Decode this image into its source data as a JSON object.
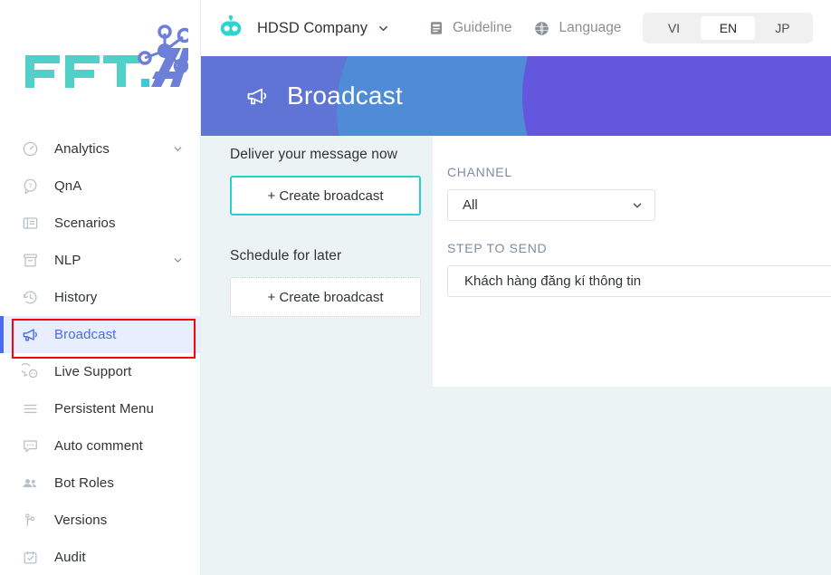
{
  "brand": {
    "logo_text": "FPT.AI"
  },
  "sidebar": {
    "items": [
      {
        "label": "Analytics",
        "icon": "gauge-icon",
        "chevron": true,
        "active": false
      },
      {
        "label": "QnA",
        "icon": "question-chat-icon",
        "chevron": false,
        "active": false
      },
      {
        "label": "Scenarios",
        "icon": "article-icon",
        "chevron": false,
        "active": false
      },
      {
        "label": "NLP",
        "icon": "archive-icon",
        "chevron": true,
        "active": false
      },
      {
        "label": "History",
        "icon": "clock-history-icon",
        "chevron": false,
        "active": false
      },
      {
        "label": "Broadcast",
        "icon": "megaphone-icon",
        "chevron": false,
        "active": true
      },
      {
        "label": "Live Support",
        "icon": "support-chat-icon",
        "chevron": false,
        "active": false
      },
      {
        "label": "Persistent Menu",
        "icon": "menu-lines-icon",
        "chevron": false,
        "active": false
      },
      {
        "label": "Auto comment",
        "icon": "comment-icon",
        "chevron": false,
        "active": false
      },
      {
        "label": "Bot Roles",
        "icon": "people-icon",
        "chevron": false,
        "active": false
      },
      {
        "label": "Versions",
        "icon": "branch-icon",
        "chevron": false,
        "active": false
      },
      {
        "label": "Audit",
        "icon": "calendar-check-icon",
        "chevron": false,
        "active": false
      }
    ],
    "active_highlight_color": "#4a6cf0",
    "annotation_color": "#f5060a"
  },
  "topbar": {
    "company_name": "HDSD Company",
    "company_icon": "robot-icon",
    "company_caret": "chevron-down-icon",
    "guideline_label": "Guideline",
    "guideline_icon": "document-icon",
    "language_label": "Language",
    "language_icon": "globe-icon",
    "languages": [
      {
        "code": "VI",
        "selected": false
      },
      {
        "code": "EN",
        "selected": true
      },
      {
        "code": "JP",
        "selected": false
      }
    ]
  },
  "banner": {
    "title": "Broadcast",
    "icon": "megaphone-icon",
    "color_base": "#5f74d4",
    "color_blue": "#4f8bd6",
    "color_purple": "#6257dd"
  },
  "main": {
    "deliver_now_title": "Deliver your message now",
    "deliver_now_button": "+ Create broadcast",
    "schedule_title": "Schedule for later",
    "schedule_button": "+ Create broadcast",
    "focus_border_color": "#27d1cf",
    "channel_label": "CHANNEL",
    "channel_value": "All",
    "channel_options": [
      "All"
    ],
    "channel_caret": "chevron-down-icon",
    "step_label": "STEP TO SEND",
    "step_value": "Khách hàng đăng kí thông tin"
  }
}
